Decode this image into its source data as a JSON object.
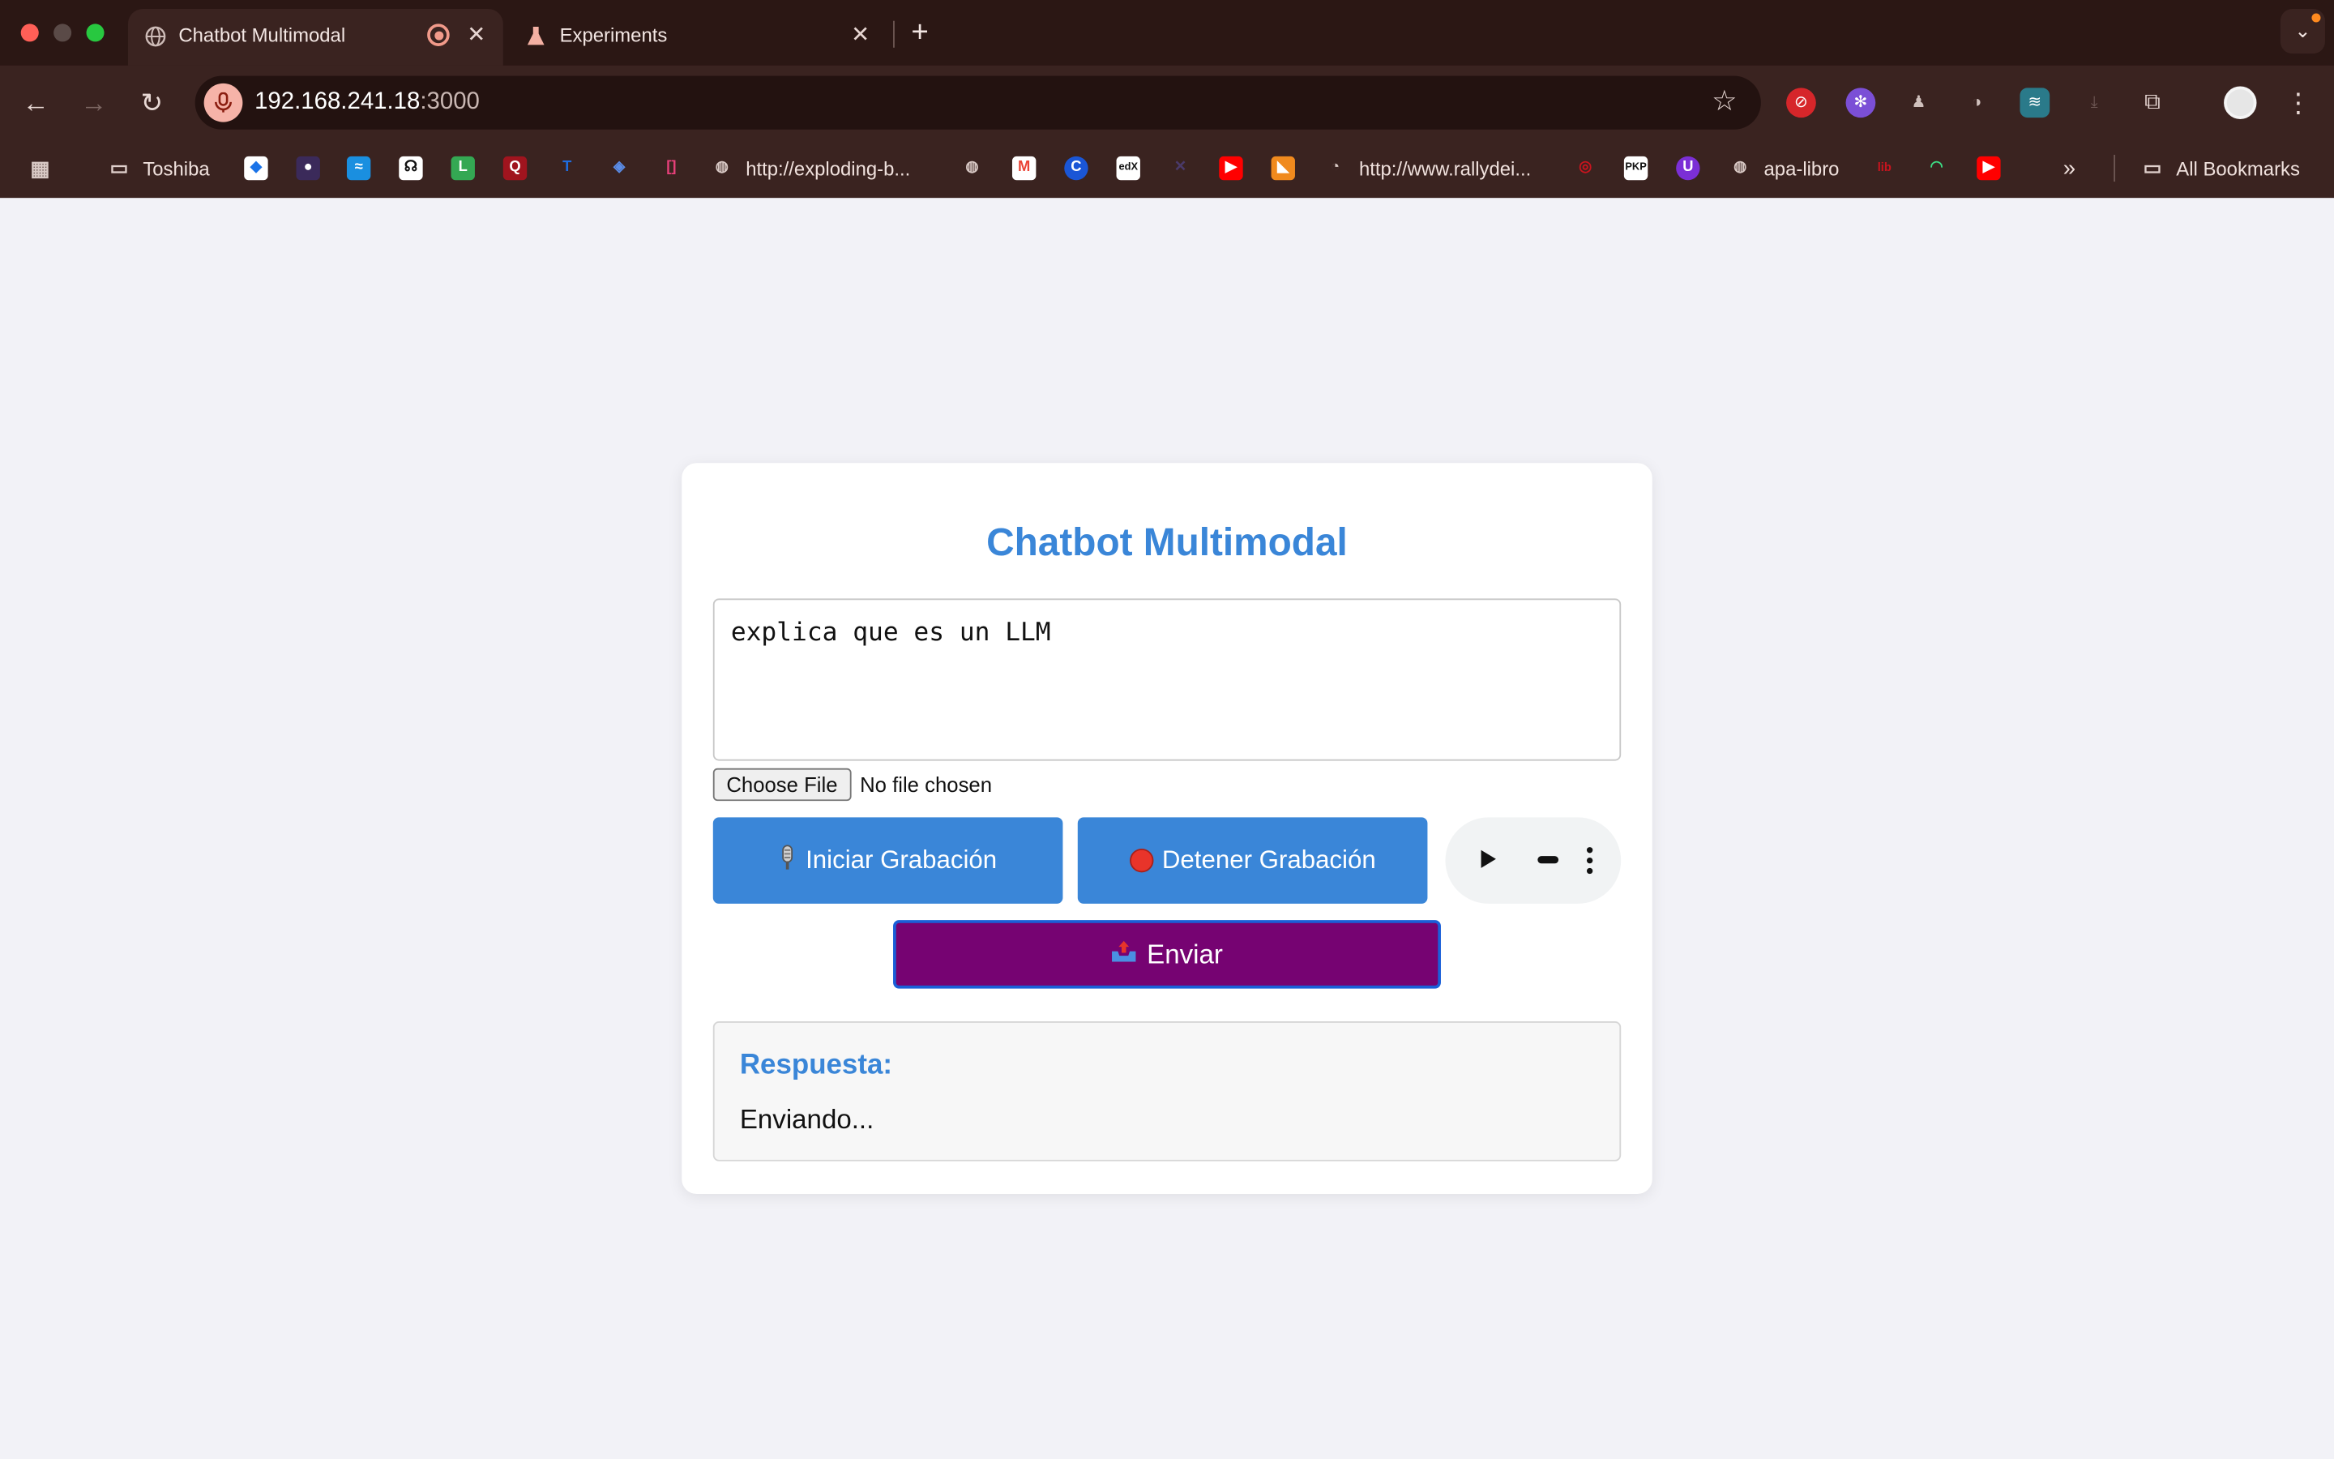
{
  "browser": {
    "tabs": [
      {
        "title": "Chatbot Multimodal",
        "active": true
      },
      {
        "title": "Experiments",
        "active": false
      }
    ],
    "url_host": "192.168.241.18",
    "url_port": ":3000",
    "bookmarks": {
      "toshiba": "Toshiba",
      "exploding": "http://exploding-b...",
      "rally": "http://www.rallydei...",
      "apa": "apa-libro",
      "all": "All Bookmarks"
    }
  },
  "app": {
    "title": "Chatbot Multimodal",
    "prompt_value": "explica que es un LLM",
    "file_button": "Choose File",
    "file_status": "No file chosen",
    "start_label": "Iniciar Grabación",
    "stop_label": "Detener Grabación",
    "send_label": "Enviar",
    "response_title": "Respuesta:",
    "response_text": "Enviando..."
  },
  "colors": {
    "accent": "#3a86d8",
    "send": "#760372",
    "chrome": "#3a2320"
  }
}
